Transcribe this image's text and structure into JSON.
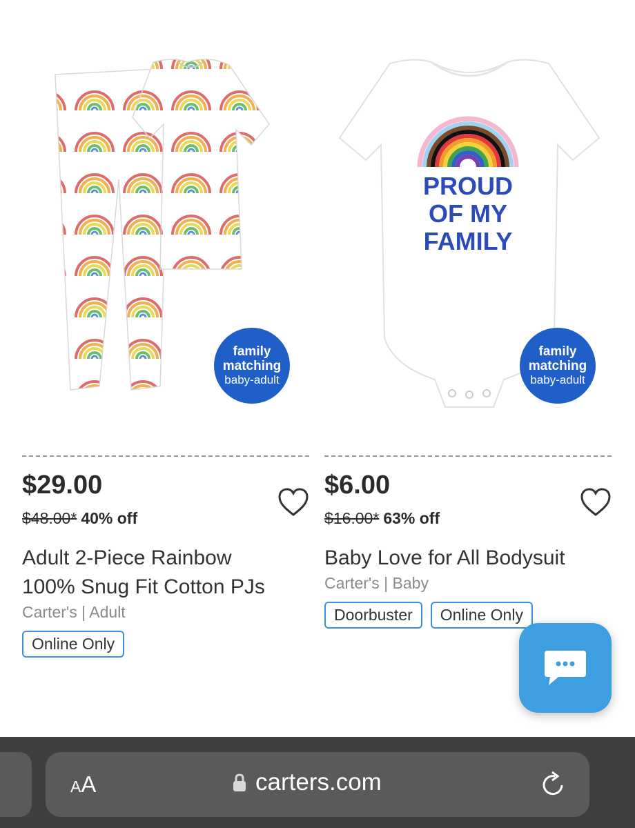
{
  "products": [
    {
      "badge": {
        "line1": "family",
        "line2": "matching",
        "line3": "baby-adult"
      },
      "price": "$29.00",
      "original_price": "$48.00",
      "original_marker": "*",
      "discount": "40% off",
      "title_line1": "Adult 2-Piece Rainbow",
      "title_line2": "100% Snug Fit Cotton PJs",
      "brand": "Carter's | Adult",
      "tags": [
        "Online Only"
      ]
    },
    {
      "badge": {
        "line1": "family",
        "line2": "matching",
        "line3": "baby-adult"
      },
      "image_text": [
        "PROUD",
        "OF MY",
        "FAMILY"
      ],
      "price": "$6.00",
      "original_price": "$16.00",
      "original_marker": "*",
      "discount": "63% off",
      "title_line1": "Baby Love for All Bodysuit",
      "brand": "Carter's | Baby",
      "tags": [
        "Doorbuster",
        "Online Only"
      ]
    }
  ],
  "browser": {
    "aa_big": "A",
    "aa_small": "A",
    "url": "carters.com"
  },
  "colors": {
    "badge": "#1f5fc7",
    "tag_border": "#3d8fd9",
    "chat_button": "#3d9fe0",
    "browser_bar": "#3f3f3f"
  },
  "icons": [
    "heart-icon",
    "chat-icon",
    "lock-icon",
    "reload-icon"
  ]
}
